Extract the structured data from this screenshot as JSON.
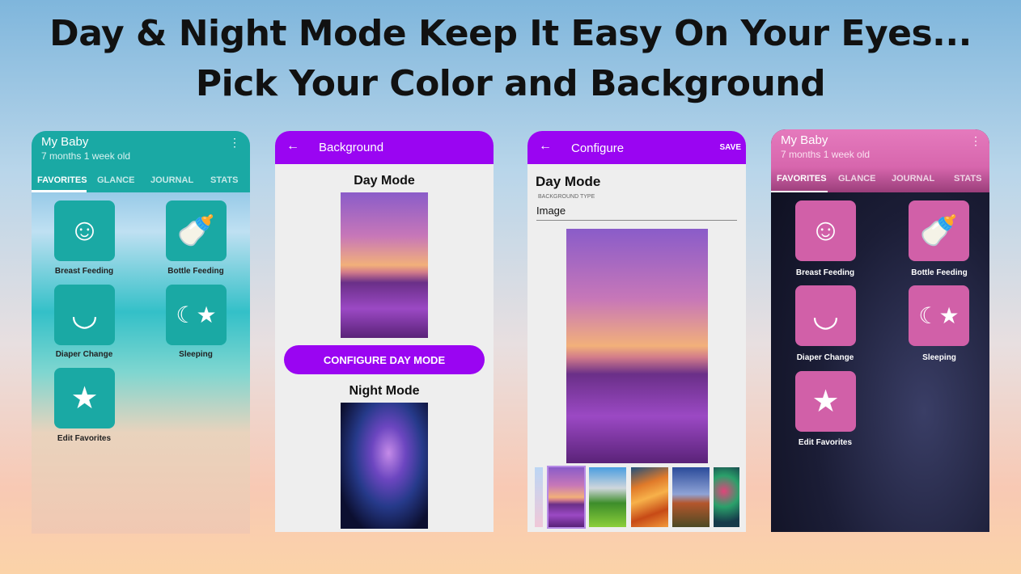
{
  "headline": {
    "line1": "Day & Night Mode Keep It Easy On Your Eyes...",
    "line2": "Pick Your Color and Background"
  },
  "colors": {
    "teal": "#1aa9a4",
    "purple": "#9a05f2",
    "pink": "#e06ab5",
    "pink_tile": "#d160a8"
  },
  "phone1": {
    "title": "My Baby",
    "subtitle": "7 months 1 week old",
    "tabs": [
      "FAVORITES",
      "GLANCE",
      "JOURNAL",
      "STATS"
    ],
    "active_tab": "FAVORITES",
    "tiles": [
      {
        "label": "Breast Feeding",
        "icon": "breastfeeding-icon"
      },
      {
        "label": "Bottle Feeding",
        "icon": "bottle-icon"
      },
      {
        "label": "Diaper Change",
        "icon": "diaper-icon"
      },
      {
        "label": "Sleeping",
        "icon": "crib-mobile-icon"
      },
      {
        "label": "Edit Favorites",
        "icon": "star-icon"
      }
    ]
  },
  "phone2": {
    "title": "Background",
    "day_heading": "Day Mode",
    "configure_button": "CONFIGURE DAY MODE",
    "night_heading": "Night Mode"
  },
  "phone3": {
    "title": "Configure",
    "save": "SAVE",
    "heading": "Day Mode",
    "field_label": "BACKGROUND TYPE",
    "field_value": "Image",
    "thumbnails": [
      "sky",
      "lavender",
      "mountains",
      "sandstone",
      "mesa",
      "coral"
    ],
    "selected_thumbnail": "lavender"
  },
  "phone4": {
    "title": "My Baby",
    "subtitle": "7 months 1 week old",
    "tabs": [
      "FAVORITES",
      "GLANCE",
      "JOURNAL",
      "STATS"
    ],
    "active_tab": "FAVORITES",
    "tiles": [
      {
        "label": "Breast Feeding"
      },
      {
        "label": "Bottle Feeding"
      },
      {
        "label": "Diaper Change"
      },
      {
        "label": "Sleeping"
      },
      {
        "label": "Edit Favorites"
      }
    ]
  }
}
